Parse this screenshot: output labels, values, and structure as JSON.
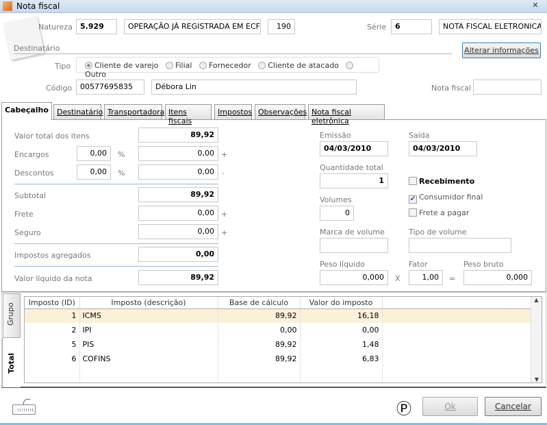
{
  "window": {
    "title": "Nota fiscal",
    "close": "✕"
  },
  "header": {
    "natureza_label": "Natureza",
    "natureza_code": "5.929",
    "natureza_desc": "OPERAÇÃO JÁ REGISTRADA EM ECF",
    "natureza_num": "190",
    "serie_label": "Série",
    "serie_value": "6",
    "serie_desc": "NOTA FISCAL ELETRONICA",
    "destinatario_section": "Destinatário",
    "alterar_button": "Alterar informações",
    "tipo_label": "Tipo",
    "tipo_options": [
      "Cliente de varejo",
      "Filial",
      "Fornecedor",
      "Cliente de atacado",
      "Outro"
    ],
    "tipo_selected": "Cliente de varejo",
    "codigo_label": "Código",
    "codigo_value": "00577695835",
    "nome_value": "Débora Lin",
    "nota_fiscal_label": "Nota fiscal",
    "nota_fiscal_value": ""
  },
  "tabs": [
    "Cabeçalho",
    "Destinatário",
    "Transportadora",
    "Itens fiscais",
    "Impostos",
    "Observações",
    "Nota fiscal eletrônica"
  ],
  "active_tab": "Cabeçalho",
  "cabecalho": {
    "valor_total_label": "Valor total dos itens",
    "valor_total": "89,92",
    "encargos_label": "Encargos",
    "encargos_pct": "0,00",
    "encargos_val": "0,00",
    "descontos_label": "Descontos",
    "descontos_pct": "0,00",
    "descontos_val": "0,00",
    "pct": "%",
    "plus": "+",
    "minus": "-",
    "subtotal_label": "Subtotal",
    "subtotal": "89,92",
    "frete_label": "Frete",
    "frete": "0,00",
    "seguro_label": "Seguro",
    "seguro": "0,00",
    "impostos_label": "Impostos agregados",
    "impostos": "0,00",
    "liquido_label": "Valor líquido da nota",
    "liquido": "89,92",
    "emissao_label": "Emissão",
    "emissao": "04/03/2010",
    "saida_label": "Saída",
    "saida": "04/03/2010",
    "quantidade_label": "Quantidade total",
    "quantidade": "1",
    "recebimento_label": "Recebimento",
    "recebimento_checked": false,
    "consumidor_label": "Consumidor final",
    "consumidor_checked": true,
    "frete_pagar_label": "Frete a pagar",
    "frete_pagar_checked": false,
    "volumes_label": "Volumes",
    "volumes": "0",
    "marca_label": "Marca de volume",
    "marca": "",
    "tipo_volume_label": "Tipo de volume",
    "tipo_volume": "",
    "peso_liquido_label": "Peso líquido",
    "peso_liquido": "0,000",
    "x": "X",
    "fator_label": "Fator",
    "fator": "1,00",
    "eq": "=",
    "peso_bruto_label": "Peso bruto",
    "peso_bruto": "0,000"
  },
  "side_tabs": [
    "Grupo",
    "Total"
  ],
  "active_side_tab": "Total",
  "impostos_table": {
    "columns": [
      "Imposto (ID)",
      "Imposto (descrição)",
      "Base de cálculo",
      "Valor do imposto"
    ],
    "rows": [
      [
        "1",
        "ICMS",
        "89,92",
        "16,18"
      ],
      [
        "2",
        "IPI",
        "0,00",
        "0,00"
      ],
      [
        "5",
        "PIS",
        "89,92",
        "1,48"
      ],
      [
        "6",
        "COFINS",
        "89,92",
        "6,83"
      ]
    ]
  },
  "footer": {
    "ok": "Ok",
    "cancelar": "Cancelar",
    "p_symbol": "Ⓟ"
  }
}
